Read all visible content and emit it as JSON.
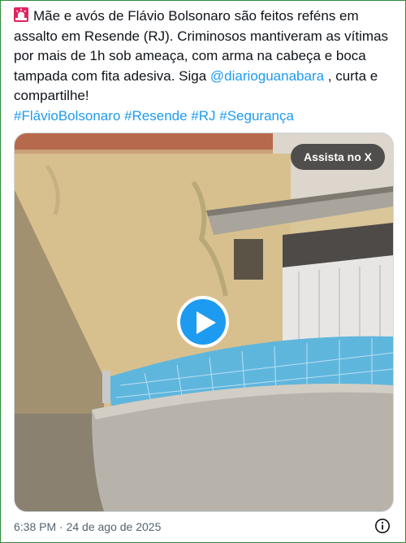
{
  "tweet": {
    "text_main": "Mãe e avós de Flávio Bolsonaro são feitos reféns em assalto em Resende (RJ). Criminosos mantiveram as vítimas por mais de 1h sob ameaça, com arma na cabeça e boca tampada com fita adesiva. Siga ",
    "mention": "@diarioguanabara",
    "text_after_mention": " , curta e compartilhe!",
    "hashtags": "#FlávioBolsonaro #Resende #RJ #Segurança"
  },
  "media": {
    "watch_label": "Assista no X"
  },
  "timestamp": "6:38 PM · 24 de ago de 2025",
  "colors": {
    "link": "#1d9bf0",
    "text": "#0f1419",
    "muted": "#536471",
    "frame": "#2e8b3a"
  },
  "icons": [
    "siren-icon",
    "play-icon",
    "info-icon"
  ]
}
